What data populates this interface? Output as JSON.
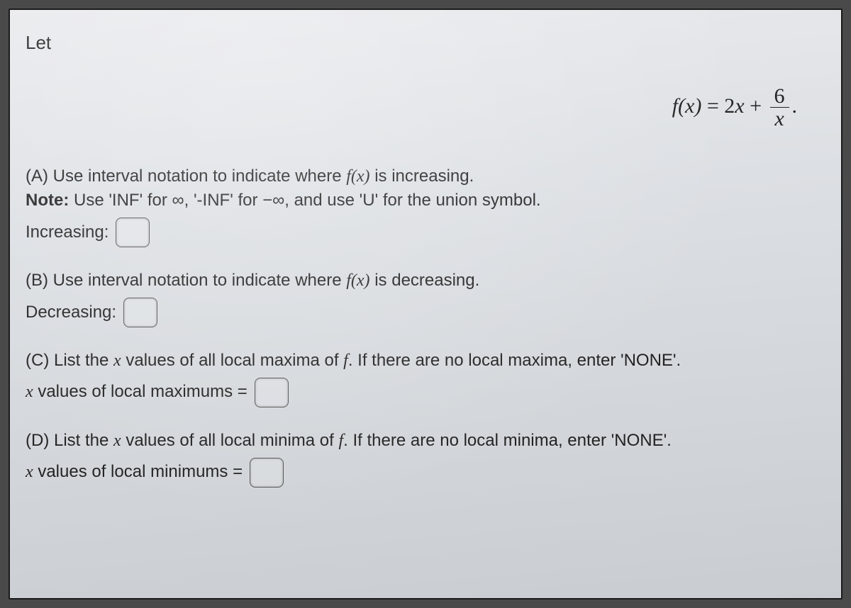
{
  "intro": "Let",
  "equation": {
    "lhs_f": "f",
    "lhs_x": "x",
    "eq": " = ",
    "term1_coef": "2",
    "term1_var": "x",
    "plus": " + ",
    "frac_num": "6",
    "frac_den": "x",
    "period": "."
  },
  "partA": {
    "prefix": "(A) Use interval notation to indicate where ",
    "fn": "f(x)",
    "suffix": " is increasing.",
    "note_bold": "Note:",
    "note_rest": " Use 'INF' for ∞, '-INF' for −∞, and use 'U' for the union symbol.",
    "label": "Increasing:"
  },
  "partB": {
    "prefix": "(B) Use interval notation to indicate where ",
    "fn": "f(x)",
    "suffix": " is decreasing.",
    "label": "Decreasing:"
  },
  "partC": {
    "prefix": "(C) List the ",
    "xvar": "x",
    "mid": " values of all local maxima of ",
    "fvar": "f",
    "suffix": ". If there are no local maxima, enter 'NONE'.",
    "label_pre_x": "x",
    "label_rest": " values of local maximums ="
  },
  "partD": {
    "prefix": "(D) List the ",
    "xvar": "x",
    "mid": " values of all local minima of ",
    "fvar": "f",
    "suffix": ". If there are no local minima, enter 'NONE'.",
    "label_pre_x": "x",
    "label_rest": " values of local minimums ="
  }
}
